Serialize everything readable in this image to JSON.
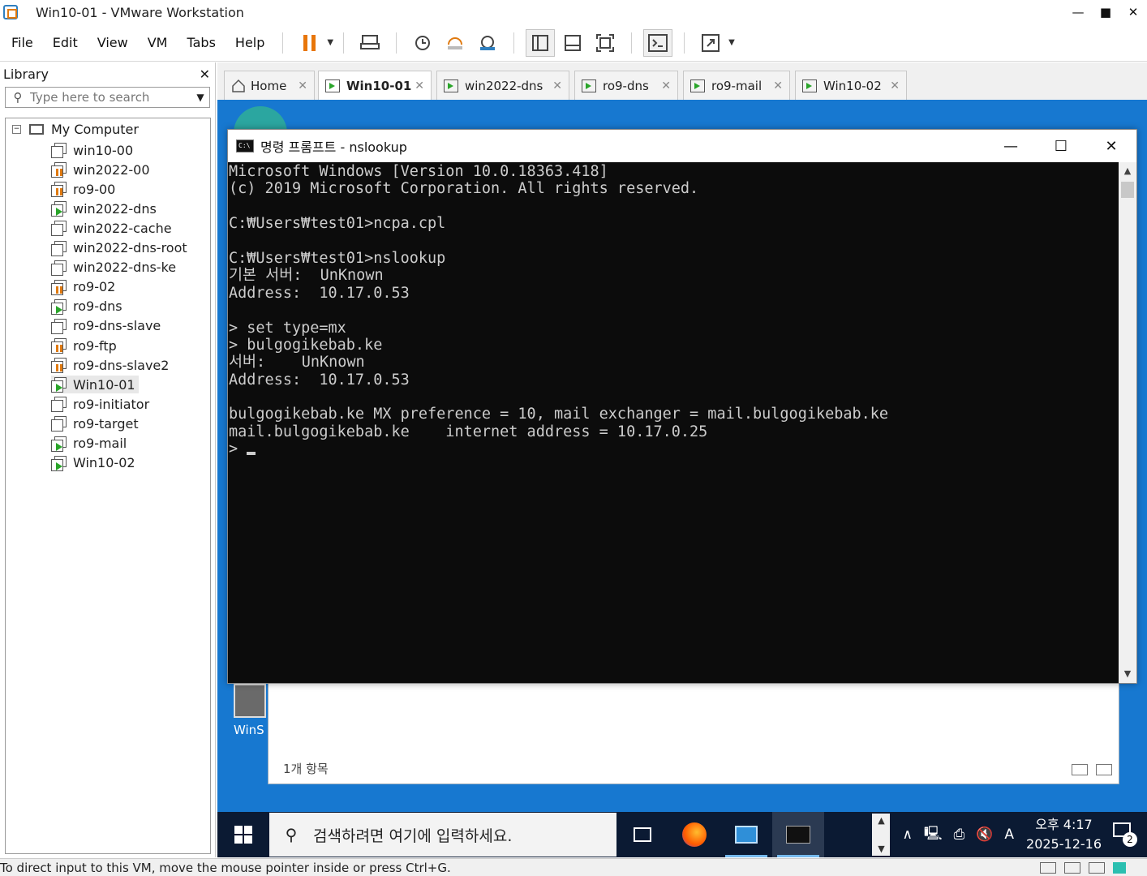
{
  "window": {
    "title": "Win10-01 - VMware Workstation",
    "controls": {
      "minimize": "—",
      "maximize": "■",
      "close": "✕"
    }
  },
  "menu": [
    "File",
    "Edit",
    "View",
    "VM",
    "Tabs",
    "Help"
  ],
  "toolbar_icons": [
    "pause-icon",
    "dropdown-caret-icon",
    "send-ctrl-alt-del-icon",
    "snapshot-take-icon",
    "snapshot-revert-icon",
    "snapshot-manager-icon",
    "show-library-icon",
    "thumbnail-bar-icon",
    "full-screen-icon",
    "console-view-icon",
    "stretch-guest-icon"
  ],
  "library": {
    "title": "Library",
    "close": "✕",
    "search_placeholder": "Type here to search",
    "root": "My Computer",
    "items": [
      {
        "label": "win10-00",
        "state": "off"
      },
      {
        "label": "win2022-00",
        "state": "paused"
      },
      {
        "label": "ro9-00",
        "state": "paused"
      },
      {
        "label": "win2022-dns",
        "state": "running"
      },
      {
        "label": "win2022-cache",
        "state": "off"
      },
      {
        "label": "win2022-dns-root",
        "state": "off"
      },
      {
        "label": "win2022-dns-ke",
        "state": "off"
      },
      {
        "label": "ro9-02",
        "state": "paused"
      },
      {
        "label": "ro9-dns",
        "state": "running"
      },
      {
        "label": "ro9-dns-slave",
        "state": "off"
      },
      {
        "label": "ro9-ftp",
        "state": "paused"
      },
      {
        "label": "ro9-dns-slave2",
        "state": "paused"
      },
      {
        "label": "Win10-01",
        "state": "running",
        "selected": true
      },
      {
        "label": "ro9-initiator",
        "state": "off"
      },
      {
        "label": "ro9-target",
        "state": "off"
      },
      {
        "label": "ro9-mail",
        "state": "running"
      },
      {
        "label": "Win10-02",
        "state": "running"
      }
    ]
  },
  "tabs": [
    {
      "label": "Home",
      "icon": "home-icon",
      "active": false
    },
    {
      "label": "Win10-01",
      "icon": "vm-running-icon",
      "active": true
    },
    {
      "label": "win2022-dns",
      "icon": "vm-running-icon",
      "active": false
    },
    {
      "label": "ro9-dns",
      "icon": "vm-running-icon",
      "active": false
    },
    {
      "label": "ro9-mail",
      "icon": "vm-running-icon",
      "active": false
    },
    {
      "label": "Win10-02",
      "icon": "vm-running-icon",
      "active": false
    }
  ],
  "tab_close": "✕",
  "guest": {
    "desktop_icon_label": "WinS",
    "explorer_status": "1개 항목",
    "cmd": {
      "title": "명령 프롬프트 - nslookup",
      "lines": [
        "Microsoft Windows [Version 10.0.18363.418]",
        "(c) 2019 Microsoft Corporation. All rights reserved.",
        "",
        "C:₩Users₩test01>ncpa.cpl",
        "",
        "C:₩Users₩test01>nslookup",
        "기본 서버:  UnKnown",
        "Address:  10.17.0.53",
        "",
        "> set type=mx",
        "> bulgogikebab.ke",
        "서버:    UnKnown",
        "Address:  10.17.0.53",
        "",
        "bulgogikebab.ke MX preference = 10, mail exchanger = mail.bulgogikebab.ke",
        "mail.bulgogikebab.ke    internet address = 10.17.0.25"
      ],
      "prompt": "> ",
      "controls": {
        "minimize": "—",
        "maximize": "☐",
        "close": "✕"
      }
    },
    "taskbar": {
      "search_placeholder": "검색하려면 여기에 입력하세요.",
      "apps": [
        "task-view-icon",
        "firefox-icon",
        "control-panel-icon",
        "cmd-icon"
      ],
      "tray_icons": [
        "chevron-up-icon",
        "network-icon",
        "printer-icon",
        "volume-muted-icon"
      ],
      "ime": "A",
      "time": "오후 4:17",
      "date": "2025-12-16",
      "notifications": "2"
    }
  },
  "status": {
    "hint": "To direct input to this VM, move the mouse pointer inside or press Ctrl+G."
  }
}
